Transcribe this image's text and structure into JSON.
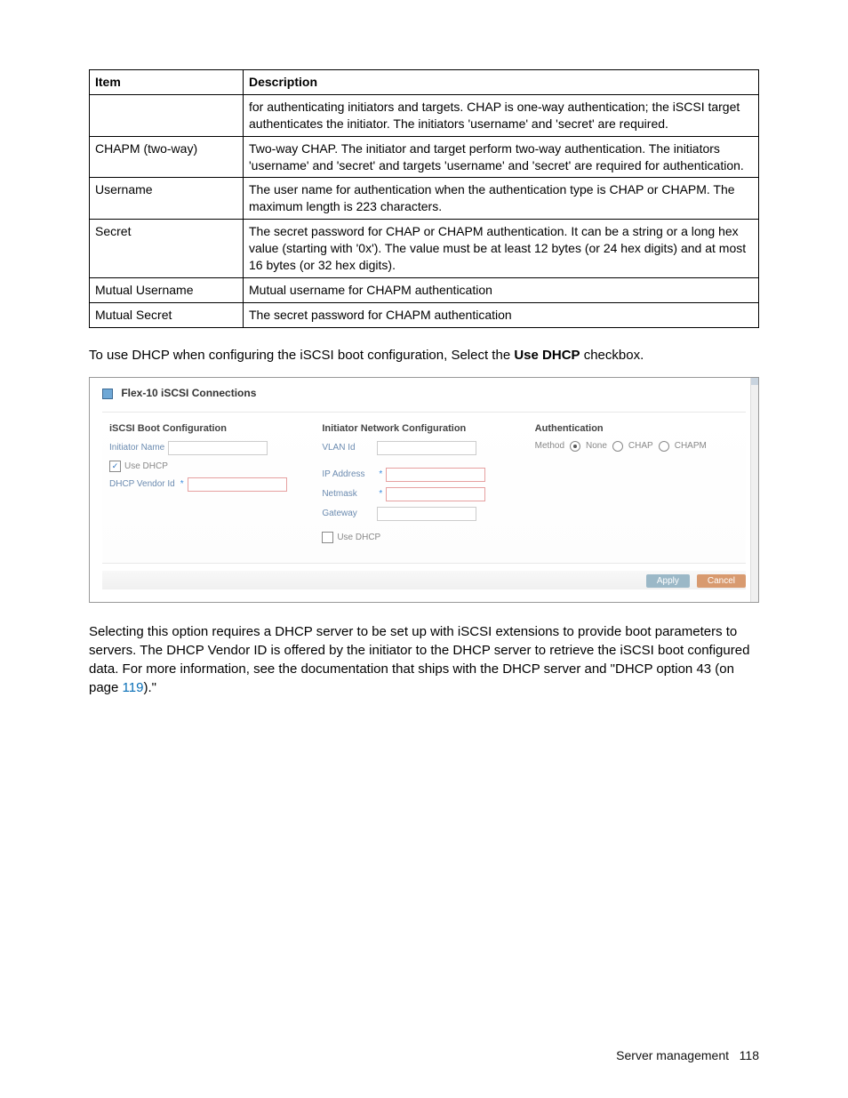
{
  "table": {
    "headers": {
      "item": "Item",
      "desc": "Description"
    },
    "rows": [
      {
        "item": "",
        "desc": "for authenticating initiators and targets. CHAP is one-way authentication; the iSCSI target authenticates the initiator. The initiators 'username' and 'secret' are required."
      },
      {
        "item": "CHAPM (two-way)",
        "desc": "Two-way CHAP. The initiator and target perform two-way authentication. The initiators 'username' and 'secret' and targets 'username' and 'secret' are required for authentication."
      },
      {
        "item": "Username",
        "desc": "The user name for authentication when the authentication type is CHAP or CHAPM. The maximum length is 223 characters."
      },
      {
        "item": "Secret",
        "desc": "The secret password for CHAP or CHAPM authentication. It can be a string or a long hex value (starting with '0x'). The value must be at least 12 bytes (or 24 hex digits) and at most 16 bytes (or 32 hex digits)."
      },
      {
        "item": "Mutual Username",
        "desc": "Mutual username for CHAPM authentication"
      },
      {
        "item": "Mutual Secret",
        "desc": "The secret password for CHAPM authentication"
      }
    ]
  },
  "para1": {
    "pre": "To use DHCP when configuring the iSCSI boot configuration, Select the ",
    "bold": "Use DHCP",
    "post": " checkbox."
  },
  "figure": {
    "title": "Flex-10 iSCSI Connections",
    "col1": {
      "title": "iSCSI Boot Configuration",
      "initiator_label": "Initiator Name",
      "use_dhcp_label": "Use DHCP",
      "use_dhcp_checked": true,
      "vendor_label": "DHCP Vendor Id"
    },
    "col2": {
      "title": "Initiator Network Configuration",
      "vlan_label": "VLAN Id",
      "ip_label": "IP Address",
      "netmask_label": "Netmask",
      "gateway_label": "Gateway",
      "use_dhcp_label": "Use DHCP",
      "use_dhcp_checked": false
    },
    "col3": {
      "title": "Authentication",
      "method_label": "Method",
      "options": {
        "none": "None",
        "chap": "CHAP",
        "chapm": "CHAPM"
      }
    },
    "buttons": {
      "apply": "Apply",
      "cancel": "Cancel"
    }
  },
  "para2": {
    "pre": "Selecting this option requires a DHCP server to be set up with iSCSI extensions to provide boot parameters to servers. The DHCP Vendor ID is offered by the initiator to the DHCP server to retrieve the iSCSI boot configured data. For more information, see the documentation that ships with the DHCP server and \"DHCP option 43 (on page ",
    "link": "119",
    "post": ").\""
  },
  "footer": {
    "section": "Server management",
    "page": "118"
  }
}
